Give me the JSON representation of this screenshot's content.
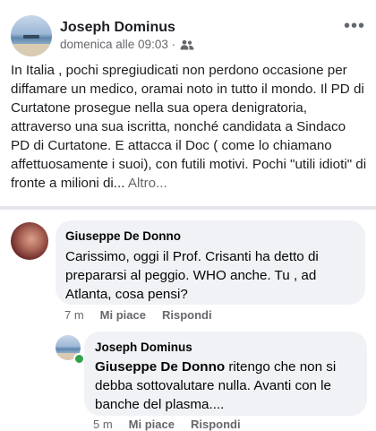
{
  "post": {
    "author": "Joseph Dominus",
    "timestamp": "domenica alle 09:03 ·",
    "audience_icon": "friends-icon",
    "more_icon": "more-options-icon",
    "more_label": "•••",
    "text": "In Italia , pochi spregiudicati non perdono occasione per diffamare un medico, oramai noto in tutto il mondo. Il PD di Curtatone prosegue nella sua opera denigratoria, attraverso una sua iscritta, nonché candidata a Sindaco PD di Curtatone. E attacca il Doc ( come lo chiamano affettuosamente i suoi), con futili motivi. Pochi \"utili idioti\" di fronte a milioni di...",
    "see_more": " Altro..."
  },
  "comments": [
    {
      "author": "Giuseppe De Donno",
      "text": "Carissimo, oggi il Prof. Crisanti ha detto di prepararsi al peggio. WHO anche. Tu , ad Atlanta, cosa pensi?",
      "time": "7 m",
      "like": "Mi piace",
      "reply": "Rispondi"
    },
    {
      "author": "Joseph Dominus",
      "mention": "Giuseppe De Donno",
      "text": " ritengo che non si debba sottovalutare nulla. Avanti con le banche del plasma....",
      "time": "5 m",
      "like": "Mi piace",
      "reply": "Rispondi"
    }
  ],
  "colors": {
    "text": "#1c1e21",
    "secondary": "#65676b",
    "bubble": "#f0f2f5",
    "online": "#31a24c"
  }
}
